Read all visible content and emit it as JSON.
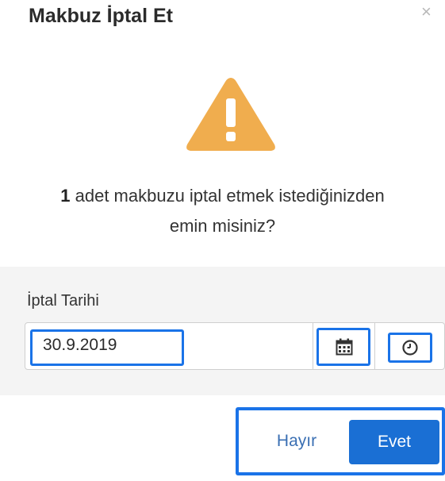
{
  "dialog": {
    "title": "Makbuz İptal Et",
    "close_symbol": "×",
    "warning_icon": "warning-triangle-icon",
    "message": {
      "count": "1",
      "text_line1": " adet makbuzu iptal etmek istediğinizden",
      "text_line2": "emin misiniz?"
    }
  },
  "date_section": {
    "label": "İptal Tarihi",
    "value": "30.9.2019",
    "calendar_icon": "calendar-icon",
    "clock_icon": "clock-icon"
  },
  "buttons": {
    "no_label": "Hayır",
    "yes_label": "Evet"
  },
  "colors": {
    "warning": "#f0ad4e",
    "primary": "#1a6fd4",
    "highlight": "#1a73e8"
  }
}
